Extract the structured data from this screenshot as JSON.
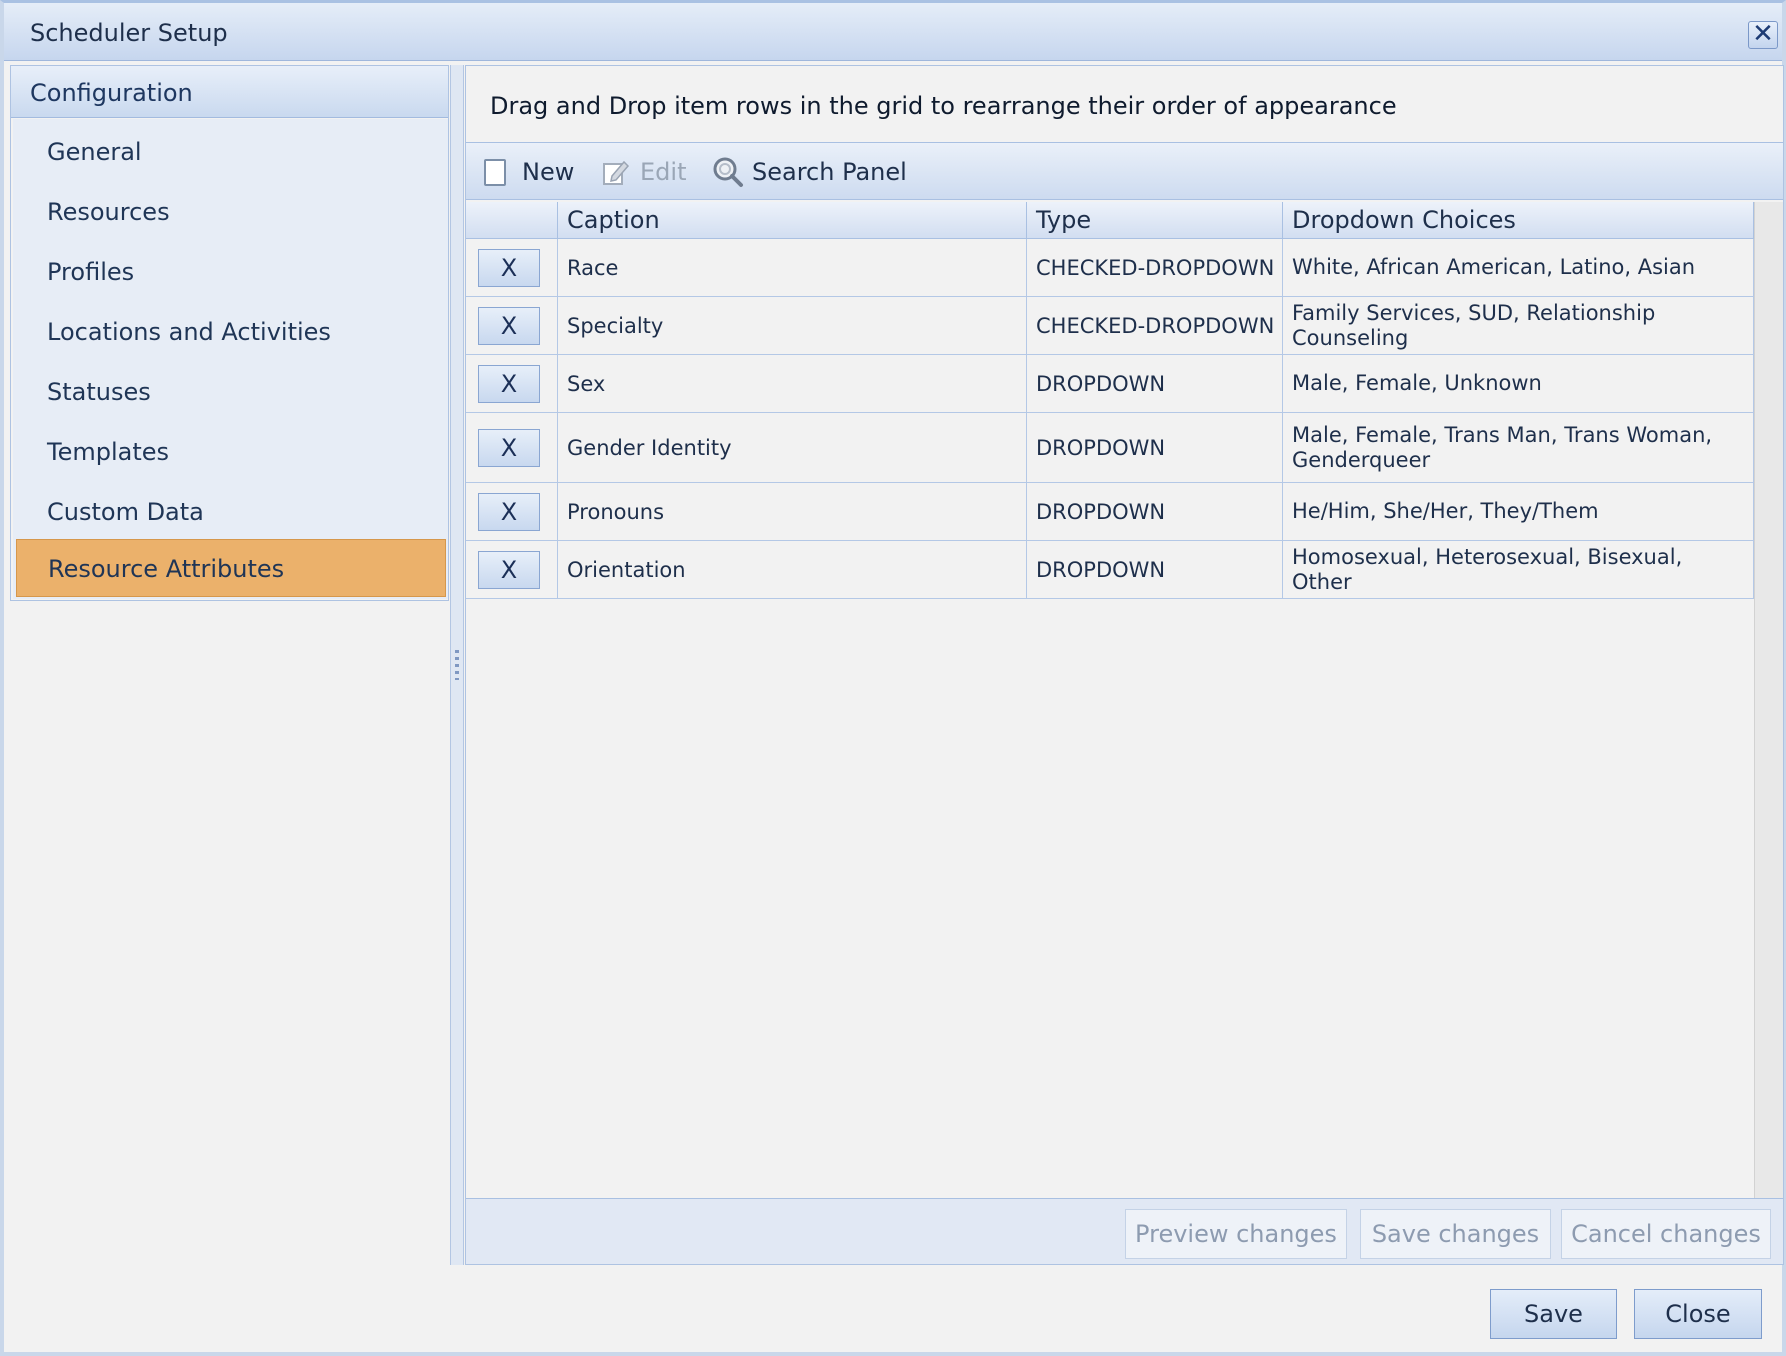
{
  "window": {
    "title": "Scheduler Setup",
    "close_glyph": "✕"
  },
  "nav": {
    "header": "Configuration",
    "items": [
      {
        "label": "General"
      },
      {
        "label": "Resources"
      },
      {
        "label": "Profiles"
      },
      {
        "label": "Locations and Activities"
      },
      {
        "label": "Statuses"
      },
      {
        "label": "Templates"
      },
      {
        "label": "Custom Data"
      },
      {
        "label": "Resource Attributes",
        "active": true
      }
    ]
  },
  "main": {
    "hint": "Drag and Drop item rows in the grid to rearrange their order of appearance",
    "toolbar": {
      "new_label": "New",
      "edit_label": "Edit",
      "search_label": "Search Panel"
    },
    "grid": {
      "columns": {
        "caption": "Caption",
        "type": "Type",
        "choices": "Dropdown Choices"
      },
      "delete_label": "X",
      "rows": [
        {
          "caption": "Race",
          "type": "CHECKED-DROPDOWN",
          "choices": "White, African American, Latino, Asian"
        },
        {
          "caption": "Specialty",
          "type": "CHECKED-DROPDOWN",
          "choices": "Family Services, SUD, Relationship Counseling"
        },
        {
          "caption": "Sex",
          "type": "DROPDOWN",
          "choices": "Male, Female, Unknown"
        },
        {
          "caption": "Gender Identity",
          "type": "DROPDOWN",
          "choices": "Male, Female, Trans Man, Trans Woman, Genderqueer"
        },
        {
          "caption": "Pronouns",
          "type": "DROPDOWN",
          "choices": "He/Him, She/Her, They/Them"
        },
        {
          "caption": "Orientation",
          "type": "DROPDOWN",
          "choices": "Homosexual, Heterosexual, Bisexual, Other"
        }
      ]
    },
    "footer": {
      "preview": "Preview changes",
      "save": "Save changes",
      "cancel": "Cancel changes"
    }
  },
  "buttons": {
    "save": "Save",
    "close": "Close"
  }
}
